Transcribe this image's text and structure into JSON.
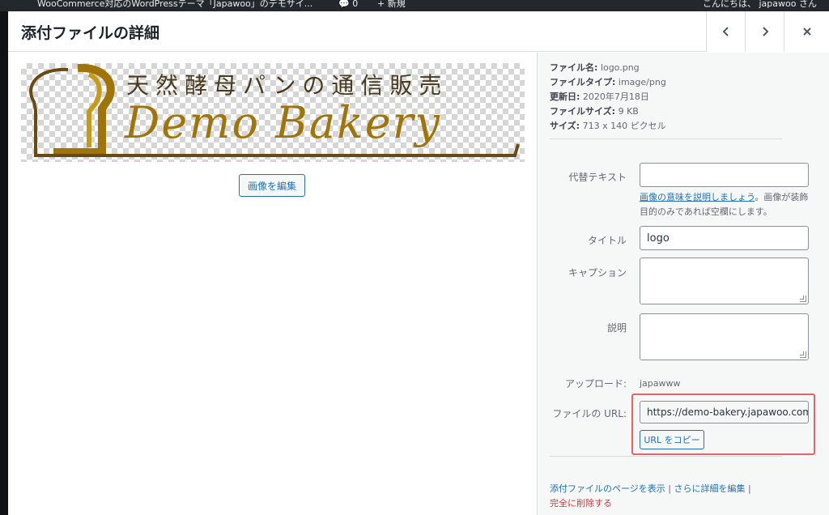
{
  "admin_bar": {
    "site_title": "WooCommerce対応のWordPressテーマ「Japawoo」のデモサイ...",
    "comments_count": "0",
    "new_label": "新規",
    "greeting": "こんにちは、 japawoo さん"
  },
  "modal": {
    "title": "添付ファイルの詳細",
    "prev_icon": "chevron-left-icon",
    "next_icon": "chevron-right-icon",
    "close_icon": "close-icon"
  },
  "image": {
    "logo_jp_text": "天然酵母パンの通信販売",
    "logo_en_text": "Demo Bakery",
    "edit_button": "画像を編集",
    "logo_color": "#a07406"
  },
  "details": {
    "filename_label": "ファイル名:",
    "filename": "logo.png",
    "filetype_label": "ファイルタイプ:",
    "filetype": "image/png",
    "updated_label": "更新日:",
    "updated": "2020年7月18日",
    "filesize_label": "ファイルサイズ:",
    "filesize": "9 KB",
    "size_label": "サイズ:",
    "size": "713 x 140 ピクセル"
  },
  "form": {
    "alt_label": "代替テキスト",
    "alt_value": "",
    "alt_help_link": "画像の意味を説明しましょう",
    "alt_help_text": "。画像が装飾目的のみであれば空欄にします。",
    "title_label": "タイトル",
    "title_value": "logo",
    "caption_label": "キャプション",
    "caption_value": "",
    "description_label": "説明",
    "description_value": "",
    "uploaded_by_label": "アップロード:",
    "uploaded_by": "japawww",
    "file_url_label": "ファイルの URL:",
    "file_url": "https://demo-bakery.japawoo.com",
    "copy_url_button": "URL をコピー",
    "highlight_color": "#e8626a"
  },
  "actions": {
    "view_page": "添付ファイルのページを表示",
    "sep1": " | ",
    "edit_more": "さらに詳細を編集",
    "sep2": " |",
    "delete": "完全に削除する"
  }
}
